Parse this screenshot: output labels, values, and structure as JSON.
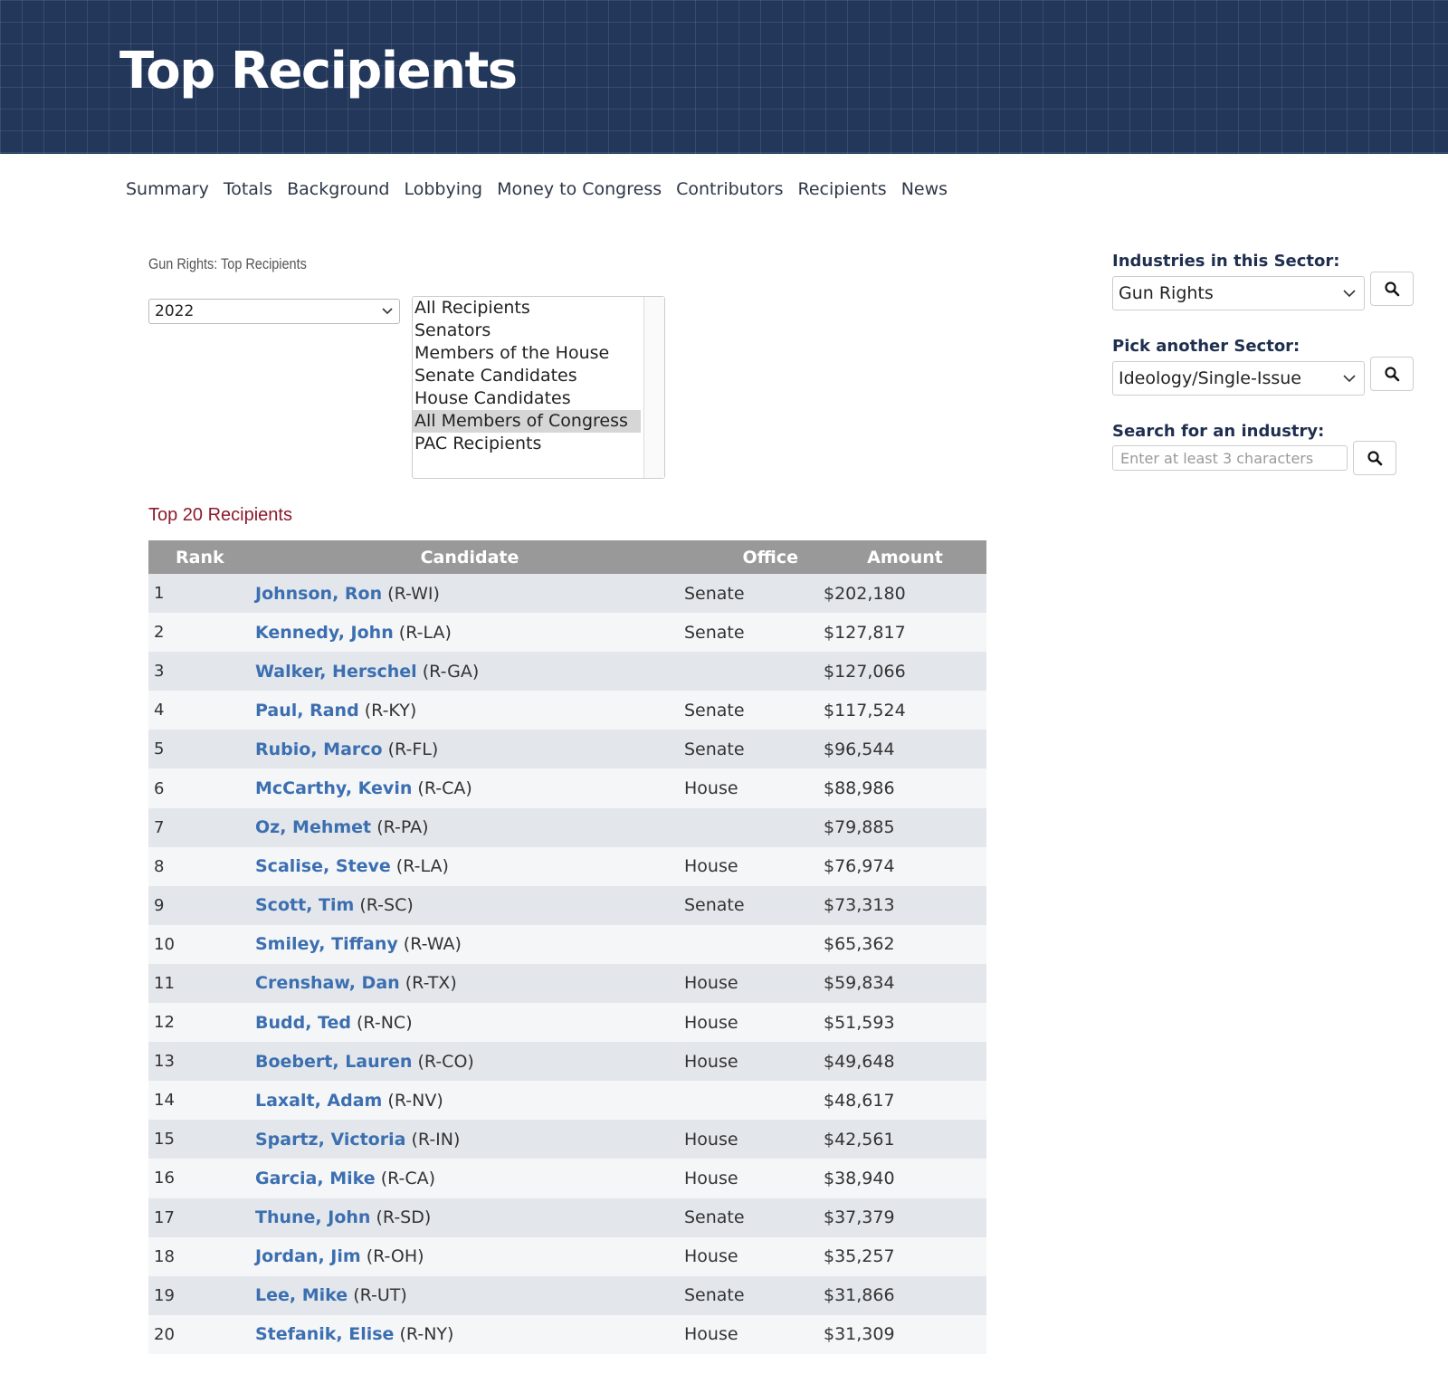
{
  "header": {
    "title": "Top Recipients"
  },
  "nav": [
    "Summary",
    "Totals",
    "Background",
    "Lobbying",
    "Money to Congress",
    "Contributors",
    "Recipients",
    "News"
  ],
  "breadcrumb": "Gun Rights: Top Recipients",
  "year_select": {
    "value": "2022"
  },
  "recipient_list": {
    "options": [
      "All Recipients",
      "Senators",
      "Members of the House",
      "Senate Candidates",
      "House Candidates",
      "All Members of Congress",
      "PAC Recipients"
    ],
    "selected": "All Members of Congress"
  },
  "table_title": "Top 20 Recipients",
  "table": {
    "columns": [
      "Rank",
      "Candidate",
      "Office",
      "Amount"
    ],
    "rows": [
      {
        "rank": "1",
        "name": "Johnson, Ron",
        "party": "(R-WI)",
        "office": "Senate",
        "amount": "$202,180"
      },
      {
        "rank": "2",
        "name": "Kennedy, John",
        "party": "(R-LA)",
        "office": "Senate",
        "amount": "$127,817"
      },
      {
        "rank": "3",
        "name": "Walker, Herschel",
        "party": "(R-GA)",
        "office": "",
        "amount": "$127,066"
      },
      {
        "rank": "4",
        "name": "Paul, Rand",
        "party": "(R-KY)",
        "office": "Senate",
        "amount": "$117,524"
      },
      {
        "rank": "5",
        "name": "Rubio, Marco",
        "party": "(R-FL)",
        "office": "Senate",
        "amount": "$96,544"
      },
      {
        "rank": "6",
        "name": "McCarthy, Kevin",
        "party": "(R-CA)",
        "office": "House",
        "amount": "$88,986"
      },
      {
        "rank": "7",
        "name": "Oz, Mehmet",
        "party": "(R-PA)",
        "office": "",
        "amount": "$79,885"
      },
      {
        "rank": "8",
        "name": "Scalise, Steve",
        "party": "(R-LA)",
        "office": "House",
        "amount": "$76,974"
      },
      {
        "rank": "9",
        "name": "Scott, Tim",
        "party": "(R-SC)",
        "office": "Senate",
        "amount": "$73,313"
      },
      {
        "rank": "10",
        "name": "Smiley, Tiffany",
        "party": "(R-WA)",
        "office": "",
        "amount": "$65,362"
      },
      {
        "rank": "11",
        "name": "Crenshaw, Dan",
        "party": "(R-TX)",
        "office": "House",
        "amount": "$59,834"
      },
      {
        "rank": "12",
        "name": "Budd, Ted",
        "party": "(R-NC)",
        "office": "House",
        "amount": "$51,593"
      },
      {
        "rank": "13",
        "name": "Boebert, Lauren",
        "party": "(R-CO)",
        "office": "House",
        "amount": "$49,648"
      },
      {
        "rank": "14",
        "name": "Laxalt, Adam",
        "party": "(R-NV)",
        "office": "",
        "amount": "$48,617"
      },
      {
        "rank": "15",
        "name": "Spartz, Victoria",
        "party": "(R-IN)",
        "office": "House",
        "amount": "$42,561"
      },
      {
        "rank": "16",
        "name": "Garcia, Mike",
        "party": "(R-CA)",
        "office": "House",
        "amount": "$38,940"
      },
      {
        "rank": "17",
        "name": "Thune, John",
        "party": "(R-SD)",
        "office": "Senate",
        "amount": "$37,379"
      },
      {
        "rank": "18",
        "name": "Jordan, Jim",
        "party": "(R-OH)",
        "office": "House",
        "amount": "$35,257"
      },
      {
        "rank": "19",
        "name": "Lee, Mike",
        "party": "(R-UT)",
        "office": "Senate",
        "amount": "$31,866"
      },
      {
        "rank": "20",
        "name": "Stefanik, Elise",
        "party": "(R-NY)",
        "office": "House",
        "amount": "$31,309"
      }
    ]
  },
  "sidebar": {
    "industries_label": "Industries in this Sector:",
    "industries_value": "Gun Rights",
    "sector_label": "Pick another Sector:",
    "sector_value": "Ideology/Single-Issue",
    "search_label": "Search for an industry:",
    "search_placeholder": "Enter at least 3 characters",
    "search_icon": "magnifier-icon"
  },
  "colors": {
    "banner": "#22375a",
    "link": "#3c6fb0",
    "table_title": "#8b1a2b",
    "table_header": "#999999",
    "sidebar_label": "#1f2f4f"
  }
}
